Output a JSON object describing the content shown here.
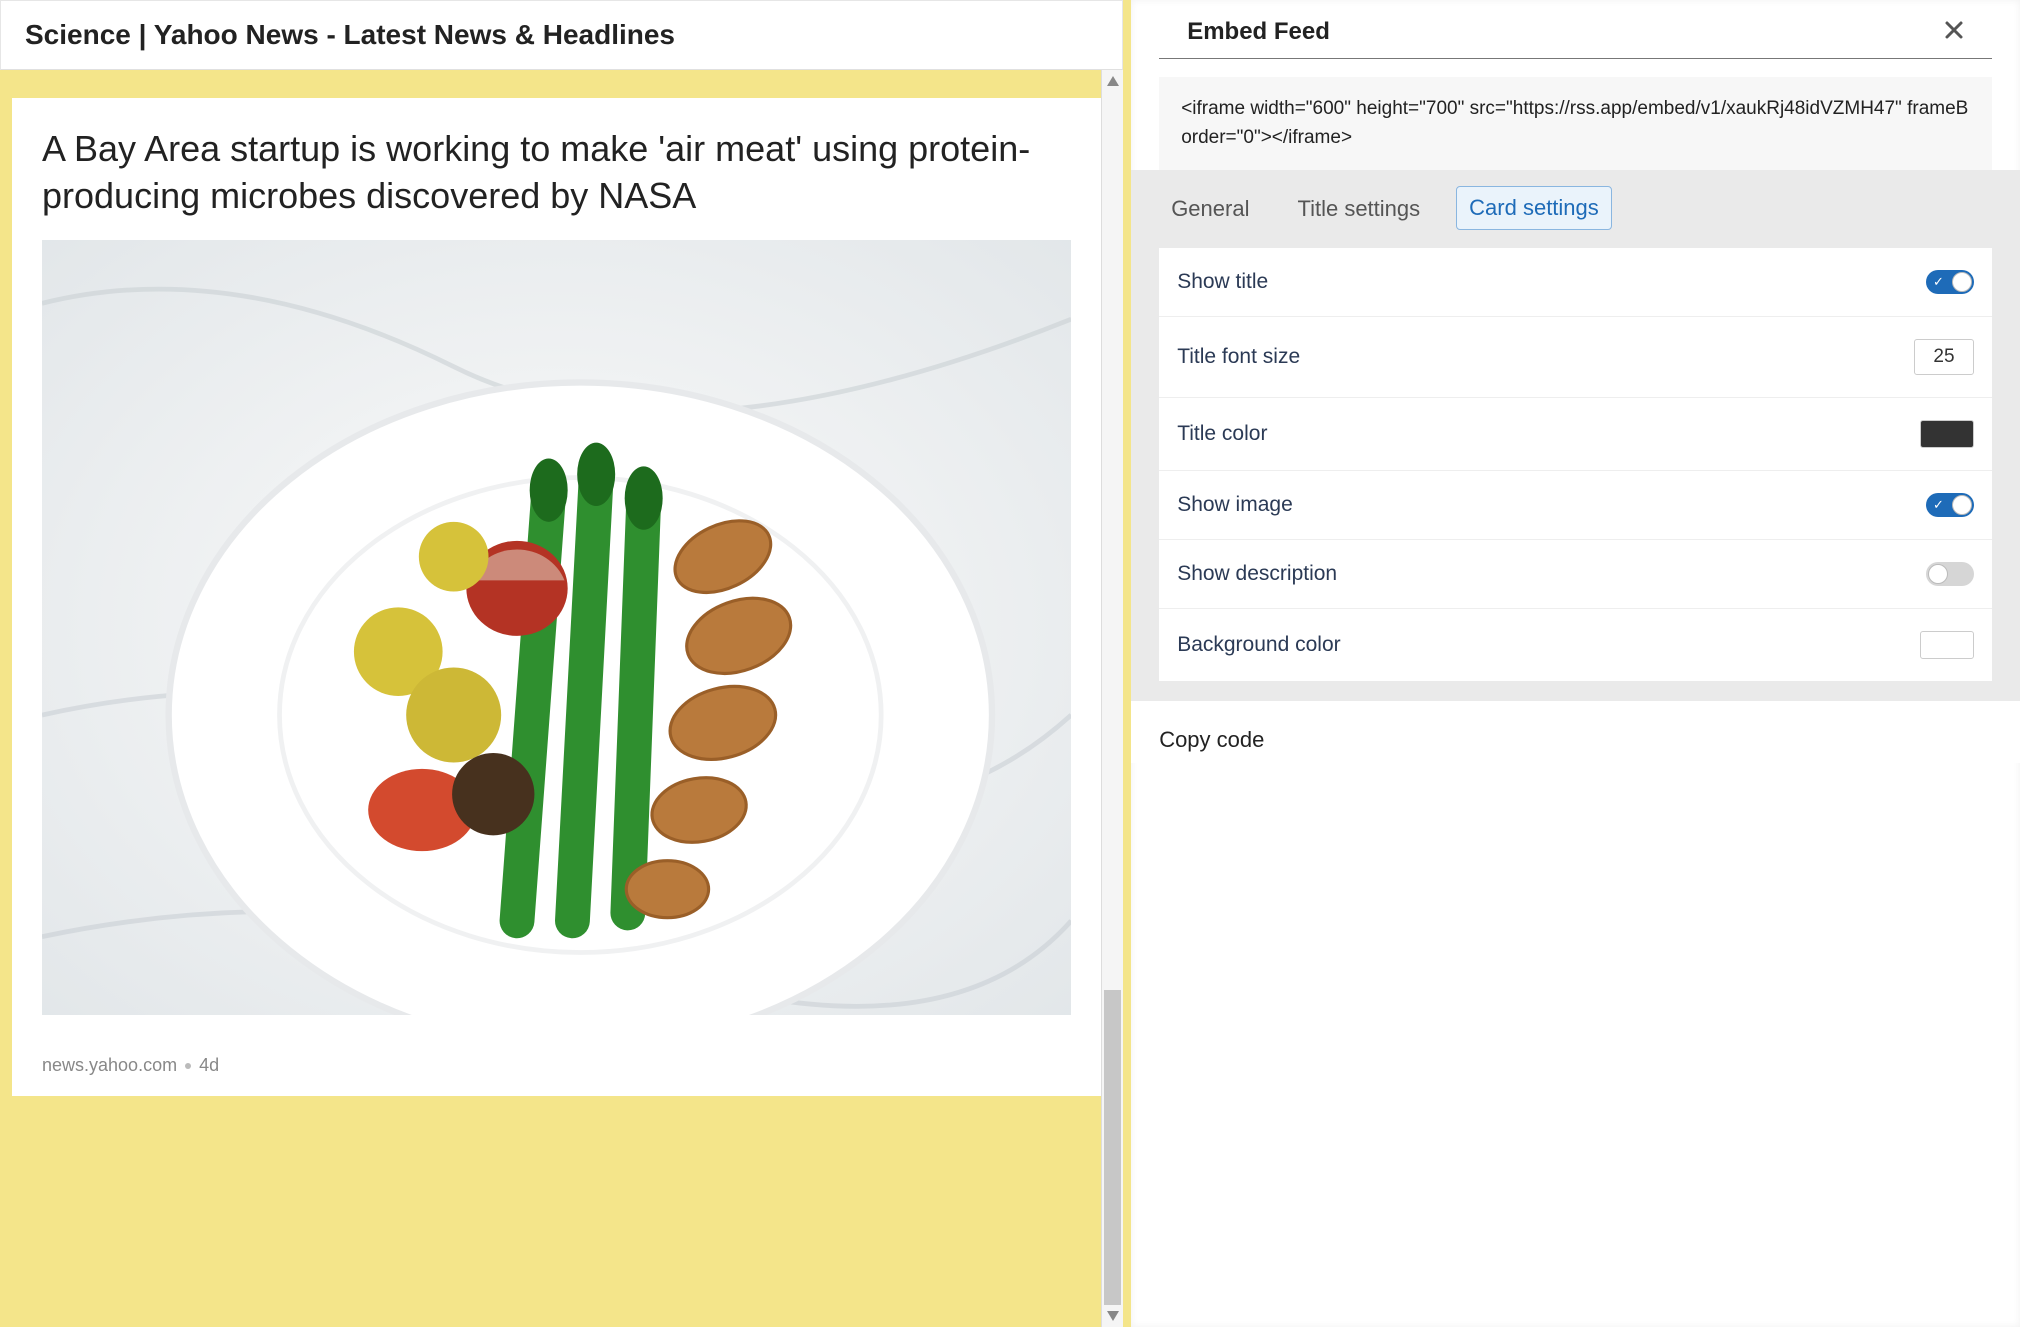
{
  "preview": {
    "feed_title": "Science | Yahoo News - Latest News & Headlines",
    "card": {
      "title": "A Bay Area startup is working to make 'air meat' using protein-producing microbes discovered by NASA",
      "source": "news.yahoo.com",
      "age": "4d"
    }
  },
  "settings": {
    "header": "Embed Feed",
    "code": "<iframe width=\"600\" height=\"700\" src=\"https://rss.app/embed/v1/xaukRj48idVZMH47\" frameBorder=\"0\"></iframe>",
    "tabs": {
      "general": "General",
      "title": "Title settings",
      "card": "Card settings"
    },
    "card_settings": {
      "show_title_label": "Show title",
      "show_title": true,
      "title_font_size_label": "Title font size",
      "title_font_size": "25",
      "title_color_label": "Title color",
      "title_color": "#333333",
      "show_image_label": "Show image",
      "show_image": true,
      "show_description_label": "Show description",
      "show_description": false,
      "background_color_label": "Background color",
      "background_color": "#ffffff"
    },
    "copy_code_label": "Copy code"
  }
}
